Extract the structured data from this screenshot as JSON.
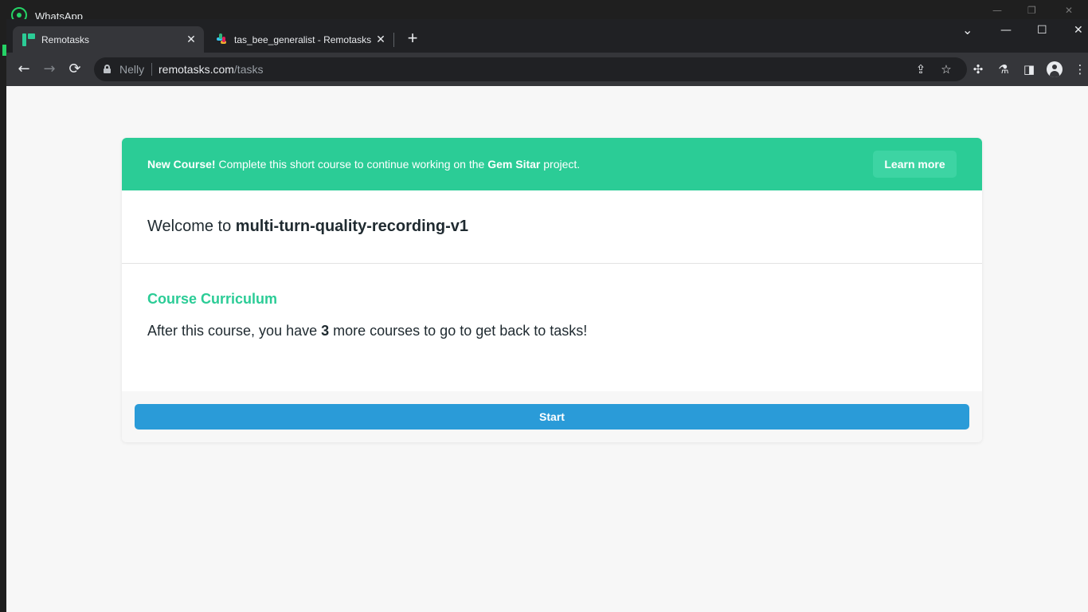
{
  "background_app": {
    "title": "WhatsApp",
    "controls": {
      "minimize": "—",
      "restore": "❐",
      "close": "✕"
    }
  },
  "browser": {
    "tabs": [
      {
        "title": "Remotasks",
        "close": "✕",
        "active": true
      },
      {
        "title": "tas_bee_generalist - Remotasks",
        "close": "✕",
        "active": false
      }
    ],
    "new_tab": "+",
    "window_controls": {
      "tab_search": "⌄",
      "minimize": "—",
      "maximize": "☐",
      "close": "✕"
    },
    "nav": {
      "back": "←",
      "forward": "→",
      "reload": "⟳"
    },
    "omnibox": {
      "profile": "Nelly",
      "url_host": "remotasks.com",
      "url_path": "/tasks"
    },
    "icons": {
      "share": "⇪",
      "bookmark": "☆",
      "extensions": "✣",
      "labs": "⚗",
      "side_panel": "◨",
      "menu": "⋮"
    }
  },
  "page": {
    "banner": {
      "lead": "New Course!",
      "text_before": " Complete this short course to continue working on the ",
      "project": "Gem Sitar",
      "text_after": " project.",
      "button": "Learn more"
    },
    "welcome": {
      "prefix": "Welcome to ",
      "course_name": "multi-turn-quality-recording-v1"
    },
    "curriculum": {
      "title": "Course Curriculum",
      "text_before": "After this course, you have ",
      "count": "3",
      "text_after": " more courses to go to get back to tasks!"
    },
    "start_button": "Start"
  },
  "colors": {
    "brand_green": "#2bcc96",
    "start_blue": "#2a9bd8",
    "page_bg": "#f7f7f7",
    "chrome_dark": "#202124",
    "chrome_toolbar": "#35363a"
  }
}
